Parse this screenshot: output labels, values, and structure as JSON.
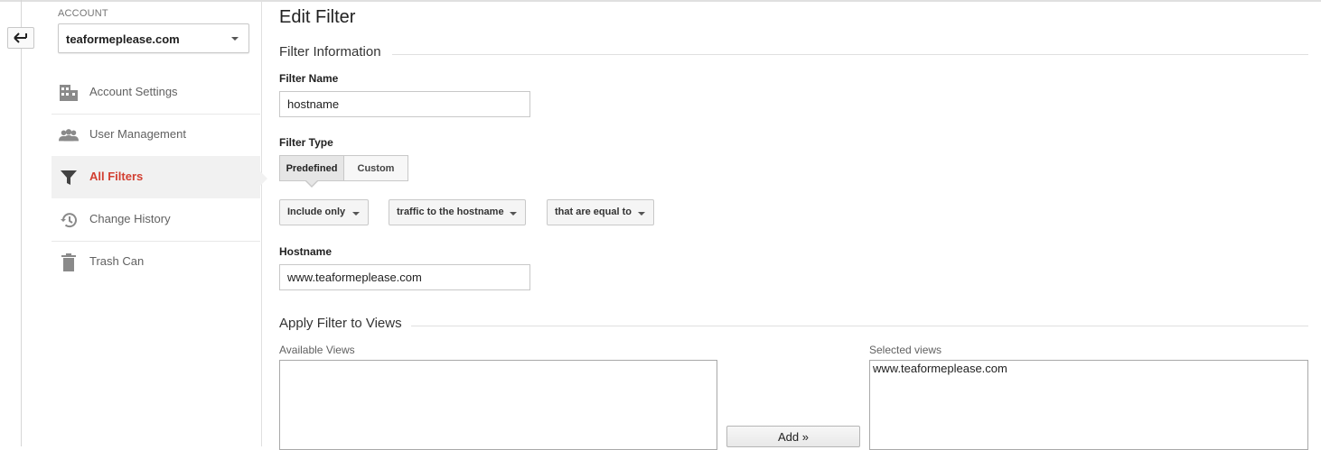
{
  "account": {
    "label": "ACCOUNT",
    "selected": "teaformeplease.com"
  },
  "sidebar": {
    "items": [
      {
        "label": "Account Settings",
        "icon": "building-icon"
      },
      {
        "label": "User Management",
        "icon": "people-icon"
      },
      {
        "label": "All Filters",
        "icon": "filter-icon",
        "active": true
      },
      {
        "label": "Change History",
        "icon": "history-icon"
      },
      {
        "label": "Trash Can",
        "icon": "trash-icon"
      }
    ],
    "active_color": "#d23f31"
  },
  "page": {
    "title": "Edit Filter"
  },
  "filter_info": {
    "section_title": "Filter Information",
    "name_label": "Filter Name",
    "name_value": "hostname",
    "type_label": "Filter Type",
    "type_options": [
      "Predefined",
      "Custom"
    ],
    "type_selected": "Predefined",
    "dropdowns": [
      "Include only",
      "traffic to the hostname",
      "that are equal to"
    ],
    "hostname_label": "Hostname",
    "hostname_value": "www.teaformeplease.com"
  },
  "views": {
    "section_title": "Apply Filter to Views",
    "available_label": "Available Views",
    "available": [],
    "selected_label": "Selected views",
    "selected": [
      "www.teaformeplease.com"
    ],
    "add_button": "Add »"
  }
}
